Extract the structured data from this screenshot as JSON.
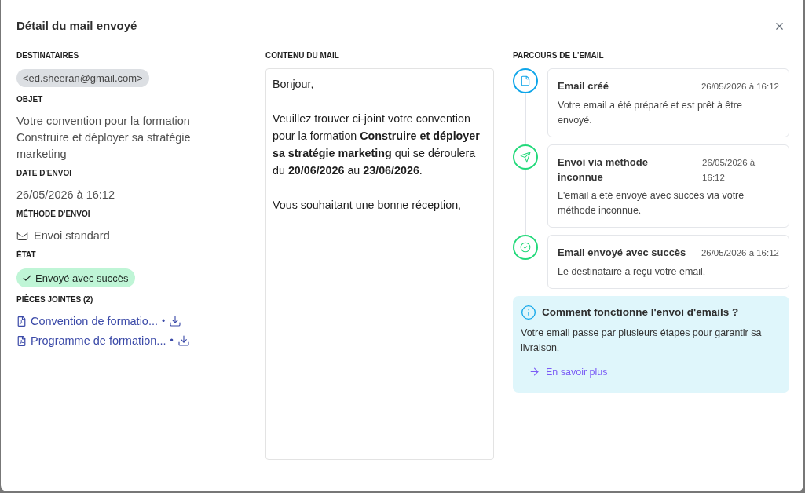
{
  "dialog": {
    "title": "Détail du mail envoyé"
  },
  "details": {
    "recipients": {
      "label": "DESTINATAIRES",
      "items": [
        "<ed.sheeran@gmail.com>"
      ]
    },
    "subject": {
      "label": "OBJET",
      "value": "Votre convention pour la formation Construire et déployer sa stratégie marketing"
    },
    "sent_date": {
      "label": "DATE D'ENVOI",
      "value": "26/05/2026 à 16:12"
    },
    "send_method": {
      "label": "MÉTHODE D'ENVOI",
      "value": "Envoi standard"
    },
    "status": {
      "label": "ÉTAT",
      "value": "Envoyé avec succès",
      "kind": "success"
    },
    "attachments": {
      "label": "PIÈCES JOINTES (2)",
      "items": [
        {
          "name": "Convention de formatio...",
          "separator": "•"
        },
        {
          "name": "Programme de formation...",
          "separator": "•"
        }
      ]
    }
  },
  "content": {
    "label": "CONTENU DU MAIL",
    "paragraphs": [
      "Bonjour,",
      "Veuillez trouver ci-joint votre convention pour la formation **Construire et déployer sa stratégie marketing** qui se déroulera du **20/06/2026** au **23/06/2026**.",
      "Vous souhaitant une bonne réception,"
    ]
  },
  "timeline": {
    "label": "PARCOURS DE L'EMAIL",
    "steps": [
      {
        "kind": "created",
        "color": "#0ea5e9",
        "title": "Email créé",
        "date": "26/05/2026 à 16:12",
        "description": "Votre email a été préparé et est prêt à être envoyé."
      },
      {
        "kind": "sent",
        "color": "#22d97a",
        "title": "Envoi via méthode inconnue",
        "date": "26/05/2026 à 16:12",
        "description": "L'email a été envoyé avec succès via votre méthode inconnue."
      },
      {
        "kind": "delivered",
        "color": "#22d97a",
        "title": "Email envoyé avec succès",
        "date": "26/05/2026 à 16:12",
        "description": "Le destinataire a reçu votre email."
      }
    ]
  },
  "info": {
    "title": "Comment fonctionne l'envoi d'emails ?",
    "text": "Votre email passe par plusieurs étapes pour garantir sa livraison.",
    "link": "En savoir plus"
  }
}
